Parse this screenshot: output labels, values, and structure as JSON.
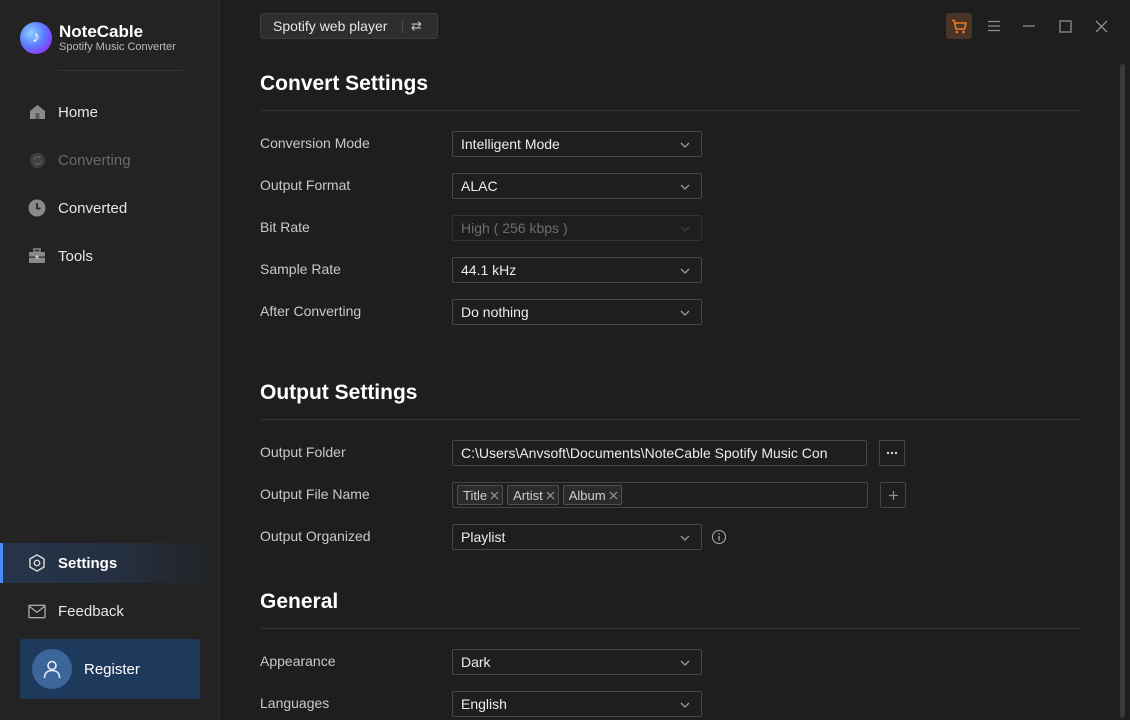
{
  "brand": {
    "name": "NoteCable",
    "subtitle": "Spotify Music Converter"
  },
  "sidebar": {
    "items": [
      {
        "label": "Home",
        "icon": "home-icon",
        "state": "normal"
      },
      {
        "label": "Converting",
        "icon": "converting-icon",
        "state": "disabled"
      },
      {
        "label": "Converted",
        "icon": "clock-icon",
        "state": "normal"
      },
      {
        "label": "Tools",
        "icon": "toolbox-icon",
        "state": "normal"
      },
      {
        "label": "Settings",
        "icon": "gear-icon",
        "state": "active"
      },
      {
        "label": "Feedback",
        "icon": "mail-icon",
        "state": "normal"
      }
    ],
    "register_label": "Register"
  },
  "topbar": {
    "source_label": "Spotify web player",
    "accent_color": "#f07a2e"
  },
  "convert_settings": {
    "title": "Convert Settings",
    "conversion_mode": {
      "label": "Conversion Mode",
      "value": "Intelligent Mode"
    },
    "output_format": {
      "label": "Output Format",
      "value": "ALAC"
    },
    "bit_rate": {
      "label": "Bit Rate",
      "value": "High ( 256 kbps )",
      "disabled": true
    },
    "sample_rate": {
      "label": "Sample Rate",
      "value": "44.1 kHz"
    },
    "after_converting": {
      "label": "After Converting",
      "value": "Do nothing"
    }
  },
  "output_settings": {
    "title": "Output Settings",
    "output_folder": {
      "label": "Output Folder",
      "value": "C:\\Users\\Anvsoft\\Documents\\NoteCable Spotify Music Con"
    },
    "output_file_name": {
      "label": "Output File Name",
      "tags": [
        "Title",
        "Artist",
        "Album"
      ]
    },
    "output_organized": {
      "label": "Output Organized",
      "value": "Playlist"
    }
  },
  "general": {
    "title": "General",
    "appearance": {
      "label": "Appearance",
      "value": "Dark"
    },
    "languages": {
      "label": "Languages",
      "value": "English"
    }
  }
}
